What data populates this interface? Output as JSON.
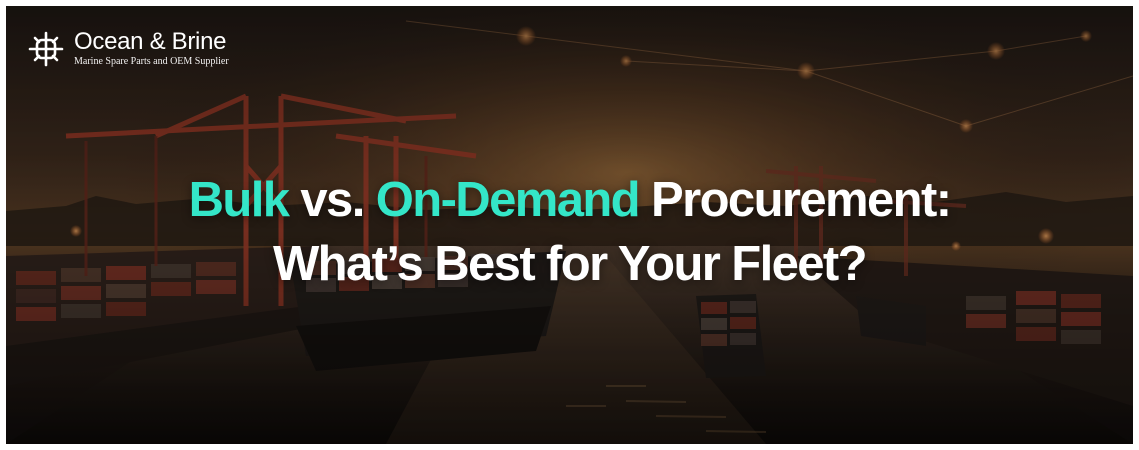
{
  "brand": {
    "name": "Ocean & Brine",
    "tagline": "Marine Spare Parts and OEM Supplier",
    "logo_icon": "ship-wheel-icon"
  },
  "headline": {
    "line1": {
      "word1": "Bulk",
      "word2": " vs. ",
      "word3": "On-Demand",
      "word4": " Procurement:"
    },
    "line2": "What’s Best for Your Fleet?"
  },
  "colors": {
    "accent": "#34e6c8",
    "text": "#ffffff",
    "background": "#1b1410"
  },
  "background_image": "port-container-terminal-at-sunset"
}
